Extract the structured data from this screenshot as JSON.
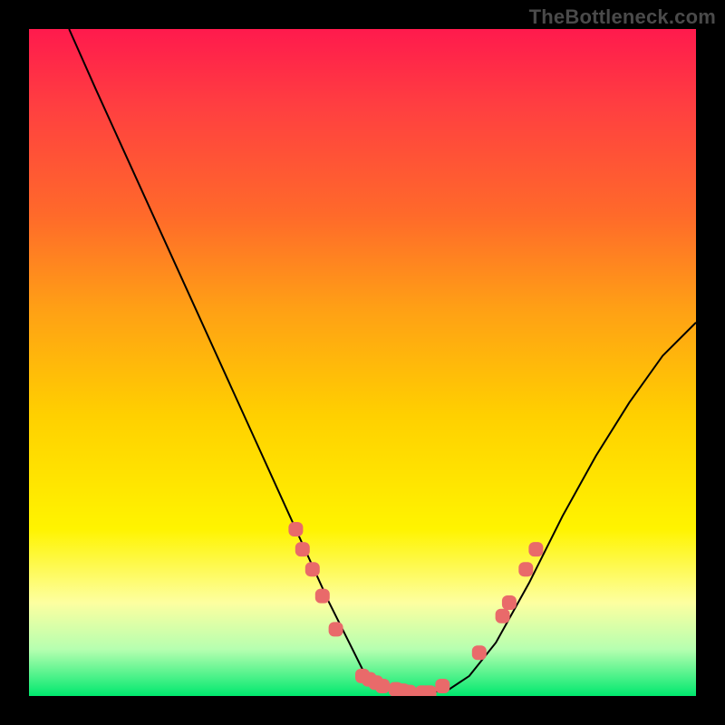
{
  "watermark": "TheBottleneck.com",
  "chart_data": {
    "type": "line",
    "title": "",
    "xlabel": "",
    "ylabel": "",
    "xlim": [
      0,
      100
    ],
    "ylim": [
      0,
      100
    ],
    "grid": false,
    "legend": false,
    "background_gradient_stops": [
      {
        "pct": 0,
        "color": "#ff1a4d"
      },
      {
        "pct": 12,
        "color": "#ff4040"
      },
      {
        "pct": 28,
        "color": "#ff6a2a"
      },
      {
        "pct": 42,
        "color": "#ffa015"
      },
      {
        "pct": 58,
        "color": "#ffd000"
      },
      {
        "pct": 75,
        "color": "#fff400"
      },
      {
        "pct": 86,
        "color": "#fdffa0"
      },
      {
        "pct": 93,
        "color": "#b6ffb0"
      },
      {
        "pct": 100,
        "color": "#00e86e"
      }
    ],
    "series": [
      {
        "name": "bottleneck-curve",
        "color": "#000000",
        "x": [
          6,
          10,
          15,
          20,
          25,
          30,
          35,
          40,
          45,
          48,
          50,
          52,
          55,
          58,
          60,
          63,
          66,
          70,
          75,
          80,
          85,
          90,
          95,
          100
        ],
        "y": [
          100,
          91,
          80,
          69,
          58,
          47,
          36,
          25,
          14,
          8,
          4,
          2,
          1,
          0.5,
          0.5,
          1,
          3,
          8,
          17,
          27,
          36,
          44,
          51,
          56
        ]
      }
    ],
    "markers": {
      "name": "highlighted-points",
      "color": "#e96a6a",
      "shape": "rounded-rect",
      "points": [
        {
          "x": 40,
          "y": 25
        },
        {
          "x": 41,
          "y": 22
        },
        {
          "x": 42.5,
          "y": 19
        },
        {
          "x": 44,
          "y": 15
        },
        {
          "x": 46,
          "y": 10
        },
        {
          "x": 50,
          "y": 3
        },
        {
          "x": 51,
          "y": 2.5
        },
        {
          "x": 52,
          "y": 2
        },
        {
          "x": 53,
          "y": 1.5
        },
        {
          "x": 55,
          "y": 1
        },
        {
          "x": 56,
          "y": 0.8
        },
        {
          "x": 57,
          "y": 0.6
        },
        {
          "x": 59,
          "y": 0.5
        },
        {
          "x": 60,
          "y": 0.5
        },
        {
          "x": 62,
          "y": 1.5
        },
        {
          "x": 67.5,
          "y": 6.5
        },
        {
          "x": 71,
          "y": 12
        },
        {
          "x": 72,
          "y": 14
        },
        {
          "x": 74.5,
          "y": 19
        },
        {
          "x": 76,
          "y": 22
        }
      ]
    }
  }
}
